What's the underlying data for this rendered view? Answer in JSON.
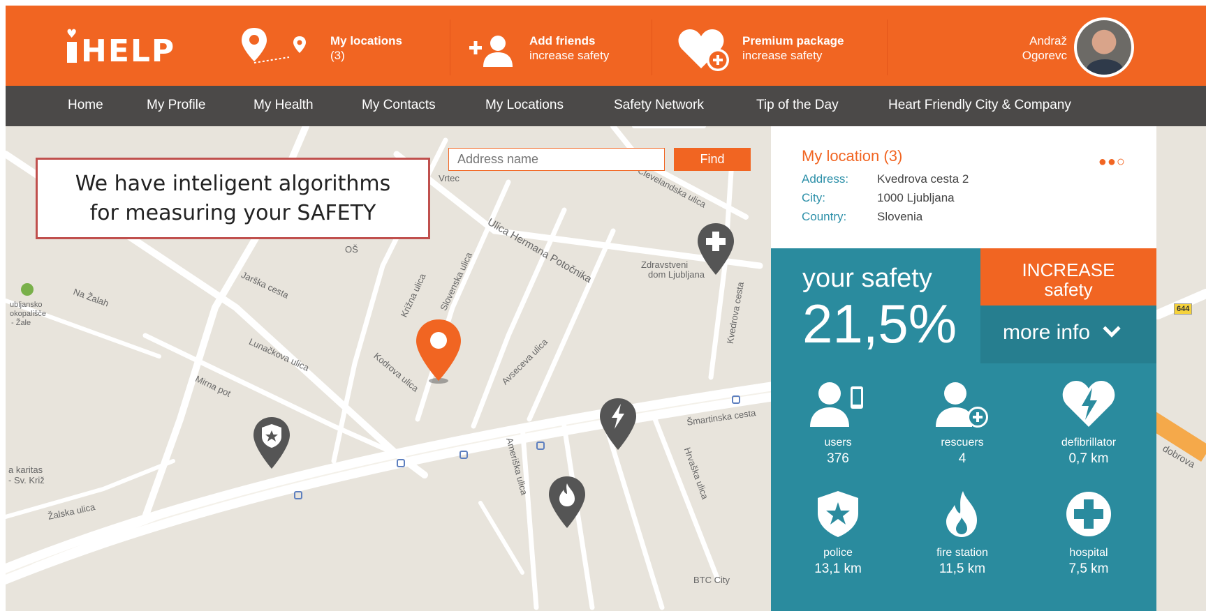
{
  "header": {
    "logo": "HELP",
    "logo_heart": "♥",
    "my_locations": {
      "title": "My locations",
      "sub": "(3)"
    },
    "add_friends": {
      "title": "Add friends",
      "sub": "increase safety"
    },
    "premium": {
      "title": "Premium package",
      "sub": "increase safety"
    },
    "user": {
      "first": "Andraž",
      "last": "Ogorevc"
    }
  },
  "nav": [
    "Home",
    "My Profile",
    "My Health",
    "My Contacts",
    "My Locations",
    "Safety Network",
    "Tip of the Day",
    "Heart Friendly City & Company"
  ],
  "search": {
    "placeholder": "Address name",
    "button": "Find"
  },
  "callout": {
    "line1": "We have inteligent algorithms",
    "line2": "for measuring your SAFETY"
  },
  "location": {
    "title": "My location (3)",
    "dots": "●●○",
    "address_label": "Address:",
    "address": "Kvedrova cesta 2",
    "city_label": "City:",
    "city": "1000 Ljubljana",
    "country_label": "Country:",
    "country": "Slovenia"
  },
  "safety": {
    "label": "your safety",
    "value": "21,5%"
  },
  "increase": {
    "line1": "INCREASE",
    "line2": "safety"
  },
  "more_info": "more info",
  "stats": [
    {
      "icon": "user-phone-icon",
      "name": "users",
      "value": "376"
    },
    {
      "icon": "rescuer-plus-icon",
      "name": "rescuers",
      "value": "4"
    },
    {
      "icon": "defibrillator-heart-icon",
      "name": "defibrillator",
      "value": "0,7 km"
    },
    {
      "icon": "police-badge-icon",
      "name": "police",
      "value": "13,1 km"
    },
    {
      "icon": "fire-icon",
      "name": "fire station",
      "value": "11,5 km"
    },
    {
      "icon": "hospital-cross-icon",
      "name": "hospital",
      "value": "7,5 km"
    }
  ],
  "map_labels": {
    "vrtec": "Vrtec",
    "os": "OŠ",
    "zdravstveni1": "Zdravstveni",
    "zdravstveni2": "dom Ljubljana",
    "na_zalah": "Na Žalah",
    "ljubljansko1": "ubljansko",
    "ljubljansko2": "okopališče",
    "ljubljansko3": "- Žale",
    "karitas1": "a karitas",
    "karitas2": "- Sv. Križ",
    "btc": "BTC City",
    "smartinska": "Šmartinska cesta",
    "kodrova": "Kodrova ulica",
    "lunackova": "Lunačkova ulica",
    "jarska": "Jarška cesta",
    "zalska": "Žalska ulica",
    "hermana": "Ulica Hermana Potočnika",
    "avseceva": "Avseceva ulica",
    "clevelandska": "Clevelandska ulica",
    "mirna": "Mirna pot",
    "krizna": "Križna ulica",
    "slovenska": "Slovenska ulica",
    "hrvaska": "Hrvaška ulica",
    "ameriska": "Ameriška ulica",
    "kvedrova": "Kvedrova cesta",
    "dobrova": "dobrova",
    "road_644": "644"
  }
}
